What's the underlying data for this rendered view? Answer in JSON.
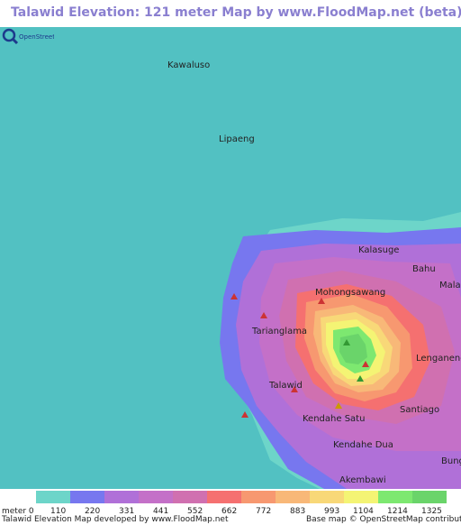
{
  "header": {
    "title": "Talawid Elevation: 121 meter Map by www.FloodMap.net (beta)"
  },
  "map": {
    "places": [
      "Kawaluso",
      "Lipaeng",
      "Kalasuge",
      "Bahu",
      "Mala",
      "Mohongsawang",
      "Tarianglama",
      "Lenganeng",
      "Talawid",
      "Kendahe Satu",
      "Santiago",
      "Kendahe Dua",
      "Bung",
      "Akembawi"
    ],
    "sea_color": "#52c1c2",
    "logo_text": "OpenStreetMap"
  },
  "legend": {
    "unit_label": "meter 0",
    "ticks": [
      "110",
      "220",
      "331",
      "441",
      "552",
      "662",
      "772",
      "883",
      "993",
      "1104",
      "1214",
      "1325"
    ],
    "colors": [
      "#6dd5c9",
      "#7777ef",
      "#b070d8",
      "#c470c8",
      "#d070b0",
      "#f57070",
      "#f79870",
      "#f8b878",
      "#f8d878",
      "#f4f474",
      "#7de870",
      "#6ad46a"
    ],
    "credit_left": "Talawid Elevation Map developed by www.FloodMap.net",
    "credit_right": "Base map © OpenStreetMap contributors"
  }
}
